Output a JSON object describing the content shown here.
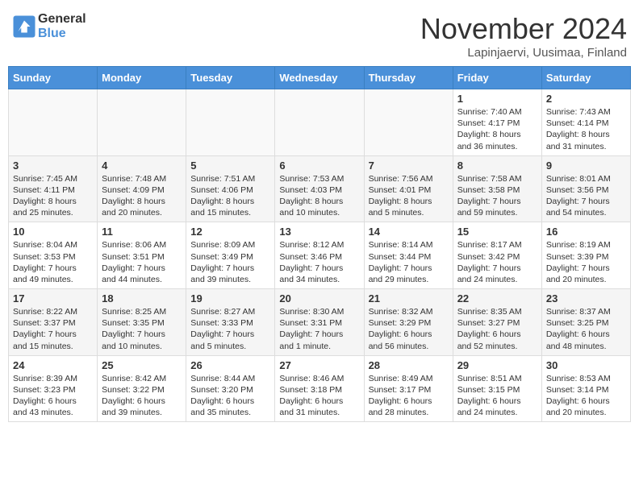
{
  "header": {
    "logo_line1": "General",
    "logo_line2": "Blue",
    "month": "November 2024",
    "location": "Lapinjaervi, Uusimaa, Finland"
  },
  "weekdays": [
    "Sunday",
    "Monday",
    "Tuesday",
    "Wednesday",
    "Thursday",
    "Friday",
    "Saturday"
  ],
  "weeks": [
    [
      {
        "day": "",
        "info": ""
      },
      {
        "day": "",
        "info": ""
      },
      {
        "day": "",
        "info": ""
      },
      {
        "day": "",
        "info": ""
      },
      {
        "day": "",
        "info": ""
      },
      {
        "day": "1",
        "info": "Sunrise: 7:40 AM\nSunset: 4:17 PM\nDaylight: 8 hours\nand 36 minutes."
      },
      {
        "day": "2",
        "info": "Sunrise: 7:43 AM\nSunset: 4:14 PM\nDaylight: 8 hours\nand 31 minutes."
      }
    ],
    [
      {
        "day": "3",
        "info": "Sunrise: 7:45 AM\nSunset: 4:11 PM\nDaylight: 8 hours\nand 25 minutes."
      },
      {
        "day": "4",
        "info": "Sunrise: 7:48 AM\nSunset: 4:09 PM\nDaylight: 8 hours\nand 20 minutes."
      },
      {
        "day": "5",
        "info": "Sunrise: 7:51 AM\nSunset: 4:06 PM\nDaylight: 8 hours\nand 15 minutes."
      },
      {
        "day": "6",
        "info": "Sunrise: 7:53 AM\nSunset: 4:03 PM\nDaylight: 8 hours\nand 10 minutes."
      },
      {
        "day": "7",
        "info": "Sunrise: 7:56 AM\nSunset: 4:01 PM\nDaylight: 8 hours\nand 5 minutes."
      },
      {
        "day": "8",
        "info": "Sunrise: 7:58 AM\nSunset: 3:58 PM\nDaylight: 7 hours\nand 59 minutes."
      },
      {
        "day": "9",
        "info": "Sunrise: 8:01 AM\nSunset: 3:56 PM\nDaylight: 7 hours\nand 54 minutes."
      }
    ],
    [
      {
        "day": "10",
        "info": "Sunrise: 8:04 AM\nSunset: 3:53 PM\nDaylight: 7 hours\nand 49 minutes."
      },
      {
        "day": "11",
        "info": "Sunrise: 8:06 AM\nSunset: 3:51 PM\nDaylight: 7 hours\nand 44 minutes."
      },
      {
        "day": "12",
        "info": "Sunrise: 8:09 AM\nSunset: 3:49 PM\nDaylight: 7 hours\nand 39 minutes."
      },
      {
        "day": "13",
        "info": "Sunrise: 8:12 AM\nSunset: 3:46 PM\nDaylight: 7 hours\nand 34 minutes."
      },
      {
        "day": "14",
        "info": "Sunrise: 8:14 AM\nSunset: 3:44 PM\nDaylight: 7 hours\nand 29 minutes."
      },
      {
        "day": "15",
        "info": "Sunrise: 8:17 AM\nSunset: 3:42 PM\nDaylight: 7 hours\nand 24 minutes."
      },
      {
        "day": "16",
        "info": "Sunrise: 8:19 AM\nSunset: 3:39 PM\nDaylight: 7 hours\nand 20 minutes."
      }
    ],
    [
      {
        "day": "17",
        "info": "Sunrise: 8:22 AM\nSunset: 3:37 PM\nDaylight: 7 hours\nand 15 minutes."
      },
      {
        "day": "18",
        "info": "Sunrise: 8:25 AM\nSunset: 3:35 PM\nDaylight: 7 hours\nand 10 minutes."
      },
      {
        "day": "19",
        "info": "Sunrise: 8:27 AM\nSunset: 3:33 PM\nDaylight: 7 hours\nand 5 minutes."
      },
      {
        "day": "20",
        "info": "Sunrise: 8:30 AM\nSunset: 3:31 PM\nDaylight: 7 hours\nand 1 minute."
      },
      {
        "day": "21",
        "info": "Sunrise: 8:32 AM\nSunset: 3:29 PM\nDaylight: 6 hours\nand 56 minutes."
      },
      {
        "day": "22",
        "info": "Sunrise: 8:35 AM\nSunset: 3:27 PM\nDaylight: 6 hours\nand 52 minutes."
      },
      {
        "day": "23",
        "info": "Sunrise: 8:37 AM\nSunset: 3:25 PM\nDaylight: 6 hours\nand 48 minutes."
      }
    ],
    [
      {
        "day": "24",
        "info": "Sunrise: 8:39 AM\nSunset: 3:23 PM\nDaylight: 6 hours\nand 43 minutes."
      },
      {
        "day": "25",
        "info": "Sunrise: 8:42 AM\nSunset: 3:22 PM\nDaylight: 6 hours\nand 39 minutes."
      },
      {
        "day": "26",
        "info": "Sunrise: 8:44 AM\nSunset: 3:20 PM\nDaylight: 6 hours\nand 35 minutes."
      },
      {
        "day": "27",
        "info": "Sunrise: 8:46 AM\nSunset: 3:18 PM\nDaylight: 6 hours\nand 31 minutes."
      },
      {
        "day": "28",
        "info": "Sunrise: 8:49 AM\nSunset: 3:17 PM\nDaylight: 6 hours\nand 28 minutes."
      },
      {
        "day": "29",
        "info": "Sunrise: 8:51 AM\nSunset: 3:15 PM\nDaylight: 6 hours\nand 24 minutes."
      },
      {
        "day": "30",
        "info": "Sunrise: 8:53 AM\nSunset: 3:14 PM\nDaylight: 6 hours\nand 20 minutes."
      }
    ]
  ]
}
